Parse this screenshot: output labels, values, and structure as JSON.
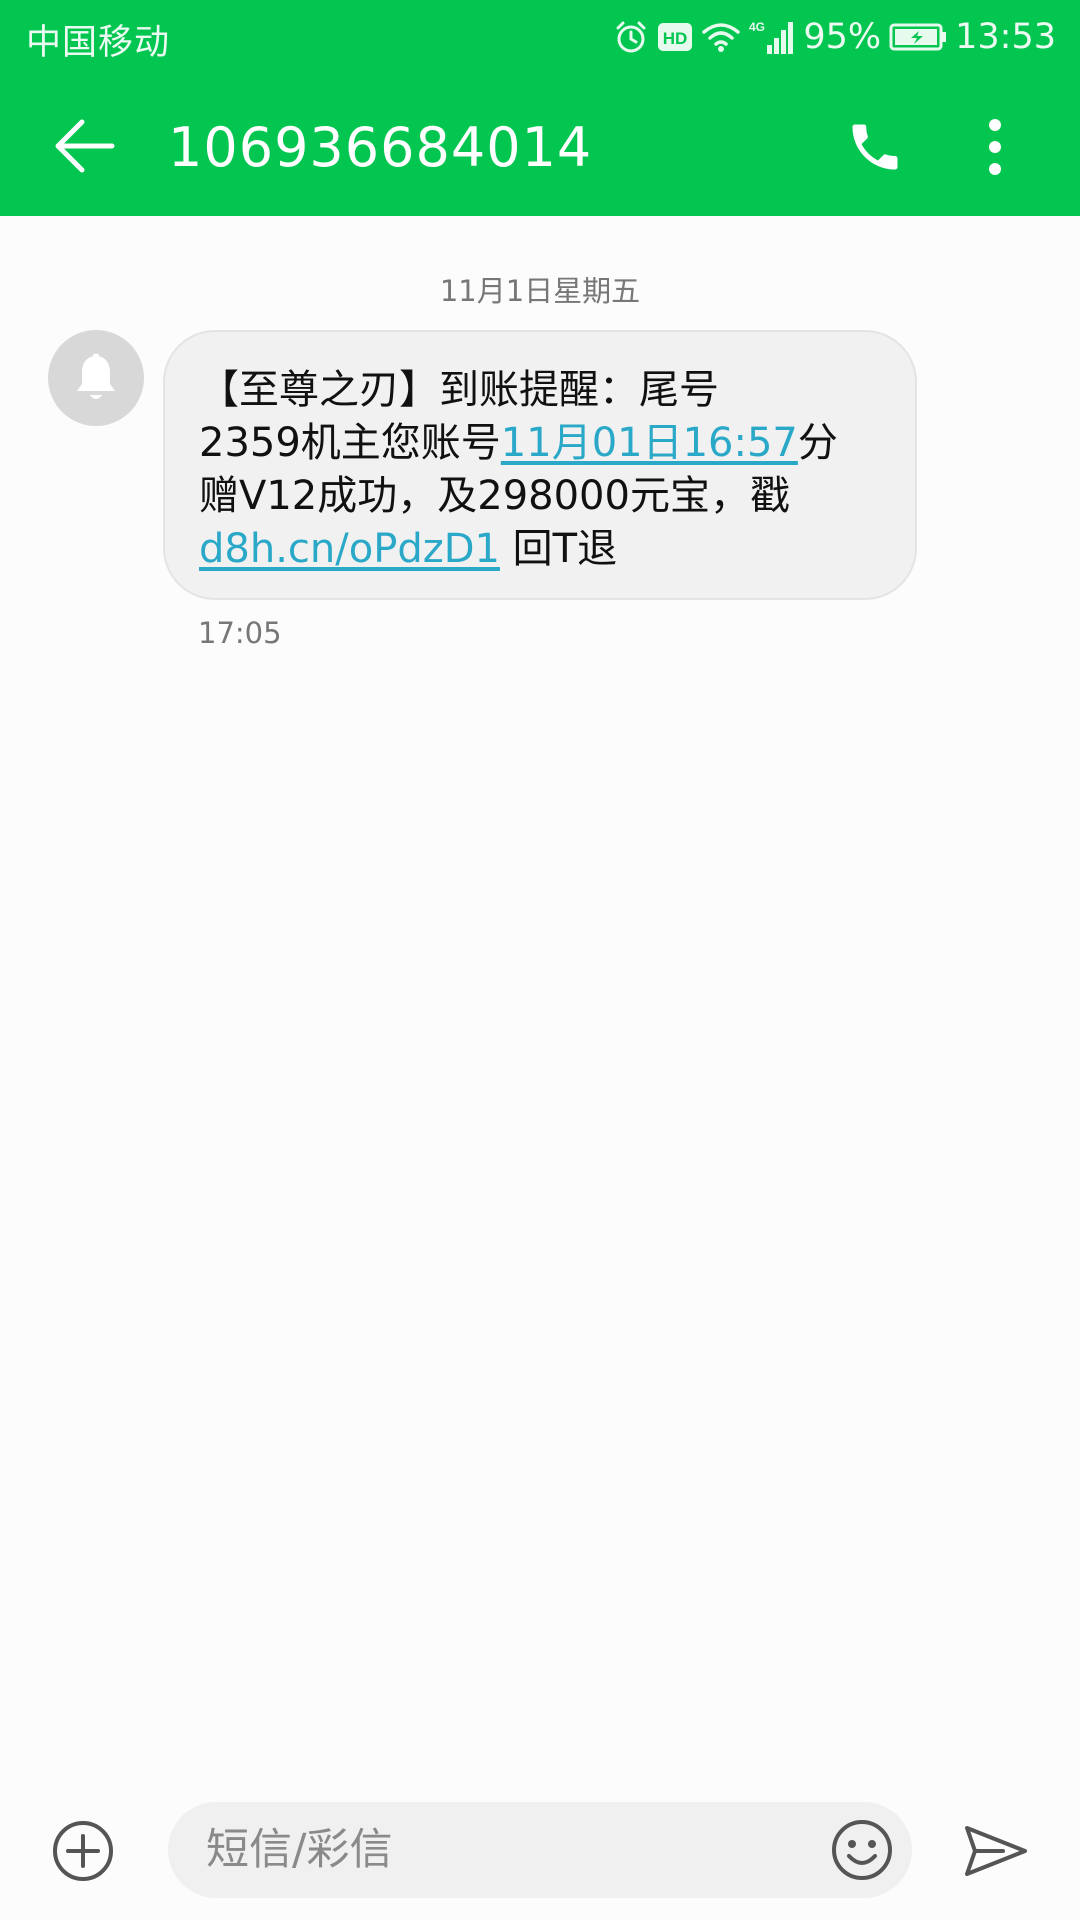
{
  "status_bar": {
    "carrier": "中国移动",
    "hd_badge": "HD",
    "network": "4G",
    "battery": "95%",
    "time": "13:53",
    "icons": [
      "alarm-icon",
      "hd-icon",
      "wifi-icon",
      "signal-icon",
      "battery-icon"
    ]
  },
  "app_bar": {
    "title": "106936684014",
    "icons": [
      "back-arrow-icon",
      "phone-icon",
      "more-vert-icon"
    ]
  },
  "conversation": {
    "date_separator": "11月1日星期五",
    "avatar_icon": "bell-icon",
    "message": {
      "line1": "【至尊之刃】到账提醒：尾号",
      "line2_prefix": "2359机主您账号",
      "line2_link": "11月01日16:57",
      "line2_suffix": "分",
      "line3": "赠V12成功，及298000元宝，戳",
      "line4_link": "d8h.cn/oPdzD1",
      "line4_suffix": " 回T退",
      "time": "17:05"
    }
  },
  "composer": {
    "placeholder": "短信/彩信",
    "icons": [
      "add-circle-icon",
      "emoji-icon",
      "send-icon"
    ]
  },
  "colors": {
    "header": "#03c651",
    "bubble": "#f1f1f1",
    "link": "#2aa8c8",
    "background": "#fcfcfc"
  }
}
